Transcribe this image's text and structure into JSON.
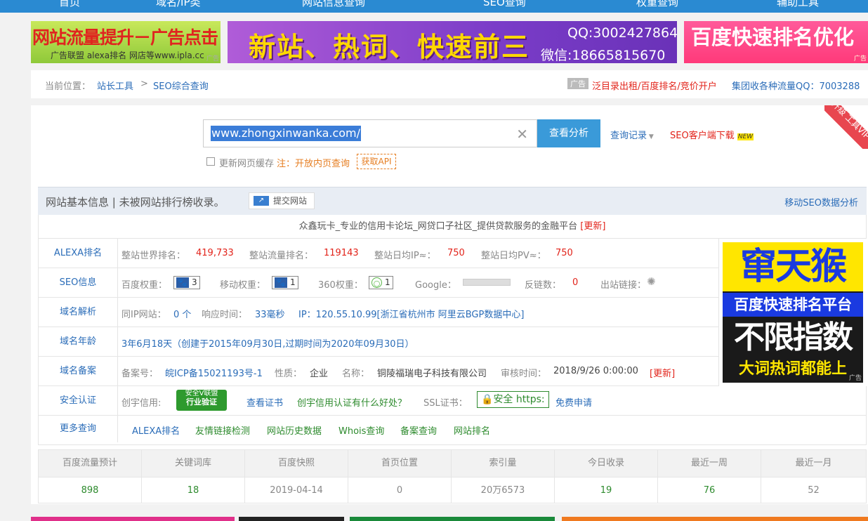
{
  "nav": [
    "首页",
    "域名/IP类",
    "网站信息查询",
    "SEO查询",
    "权重查询",
    "辅助工具"
  ],
  "ads": {
    "ad1_title": "网站流量提升－广告点击",
    "ad1_sub": "广告联盟 alexa排名 网店等www.ipla.cc",
    "ad2_title": "新站、热词、快速前三",
    "ad2_qq": "QQ:3002427864",
    "ad2_wx": "微信:18665815670",
    "ad3_title": "百度快速排名优化",
    "tag": "广告"
  },
  "breadcrumb": {
    "prefix": "当前位置：",
    "item1": "站长工具",
    "sep": ">",
    "item2": "SEO综合查询",
    "ad_tag": "广告",
    "ad_link1": "泛目录出租/百度排名/竞价开户",
    "ad_link2": "集团收各种流量QQ：7003288"
  },
  "corner": "升级\n工具VIP",
  "search": {
    "value": "www.zhongxinwanka.com/",
    "clear": "✕",
    "button": "查看分析",
    "history": "查询记录",
    "client": "SEO客户端下载",
    "new_badge": "NEW",
    "cache_label": "更新网页缓存",
    "note": "注：开放内页查询",
    "api": "获取API"
  },
  "section": {
    "title": "网站基本信息 | 未被网站排行榜收录。",
    "submit": "提交网站",
    "mobile": "移动SEO数据分析"
  },
  "site_title": "众鑫玩卡_专业的信用卡论坛_网贷口子社区_提供贷款服务的金融平台",
  "update": "[更新]",
  "alexa": {
    "label": "ALEXA排名",
    "world_label": "整站世界排名：",
    "world": "419,733",
    "traffic_label": "整站流量排名：",
    "traffic": "119143",
    "ip_label": "整站日均IP≈：",
    "ip": "750",
    "pv_label": "整站日均PV≈：",
    "pv": "750"
  },
  "seo": {
    "label": "SEO信息",
    "bd_label": "百度权重：",
    "bd": "3",
    "mobile_label": "移动权重：",
    "mobile": "1",
    "s360_label": "360权重：",
    "s360": "1",
    "google_label": "Google：",
    "backlink_label": "反链数：",
    "backlink": "0",
    "out_label": "出站链接："
  },
  "dns": {
    "label": "域名解析",
    "sameip_label": "同IP网站：",
    "sameip": "0 个",
    "resp_label": "响应时间：",
    "resp": "33毫秒",
    "ip": "IP：120.55.10.99[浙江省杭州市 阿里云BGP数据中心]"
  },
  "age": {
    "label": "域名年龄",
    "value": "3年6月18天（创建于2015年09月30日,过期时间为2020年09月30日）"
  },
  "icp": {
    "label": "域名备案",
    "no_label": "备案号：",
    "no": "皖ICP备15021193号-1",
    "type_label": "性质：",
    "type": "企业",
    "name_label": "名称：",
    "name": "铜陵福瑞电子科技有限公司",
    "time_label": "审核时间：",
    "time": "2018/9/26 0:00:00",
    "update": "[更新]"
  },
  "security": {
    "label": "安全认证",
    "cred_label": "创宇信用:",
    "cert_line1": "安全V联盟",
    "cert_line2": "行业验证",
    "view": "查看证书",
    "why": "创宇信用认证有什么好处？",
    "ssl_label": "SSL证书：",
    "ssl": "安全 https:",
    "apply": "免费申请"
  },
  "more": {
    "label": "更多查询",
    "links": [
      "ALEXA排名",
      "友情链接检测",
      "网站历史数据",
      "Whois查询",
      "备案查询",
      "网站排名"
    ]
  },
  "side_ad": {
    "l1": "窜天猴",
    "l2": "百度快速排名平台",
    "l3": "不限指数",
    "l4": "大词热词都能上"
  },
  "stats": {
    "headers": [
      "百度流量预计",
      "关键词库",
      "百度快照",
      "首页位置",
      "索引量",
      "今日收录",
      "最近一周",
      "最近一月"
    ],
    "values": [
      "898",
      "18",
      "2019-04-14",
      "0",
      "20万6573",
      "19",
      "76",
      "52"
    ]
  }
}
